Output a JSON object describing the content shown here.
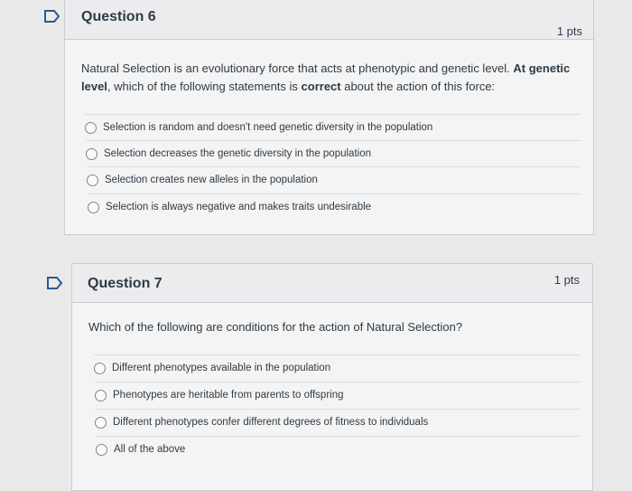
{
  "questions": [
    {
      "title": "Question 6",
      "points": "1 pts",
      "prompt": {
        "part1": "Natural Selection is an evolutionary force that acts at phenotypic and genetic level. ",
        "bold1": "At genetic level",
        "part2": ", which of the following statements is ",
        "bold2": "correct",
        "part3": " about the action of this force:"
      },
      "answers": [
        "Selection is random and doesn't need genetic diversity in the population",
        "Selection decreases the genetic diversity in the population",
        "Selection creates new alleles in the population",
        "Selection is always negative and makes traits undesirable"
      ]
    },
    {
      "title": "Question 7",
      "points": "1 pts",
      "prompt": {
        "text": "Which of the following are conditions for the action of Natural Selection?"
      },
      "answers": [
        "Different phenotypes available in the population",
        "Phenotypes are heritable from parents to offspring",
        "Different phenotypes confer different degrees of fitness to individuals",
        "All of the above"
      ]
    }
  ],
  "colors": {
    "flag_outline": "#2d5a8c",
    "background": "#e9e9ea",
    "card": "#f4f4f5"
  },
  "icons": {
    "flag": "flag-outline-icon",
    "radio": "radio-unselected-icon"
  }
}
